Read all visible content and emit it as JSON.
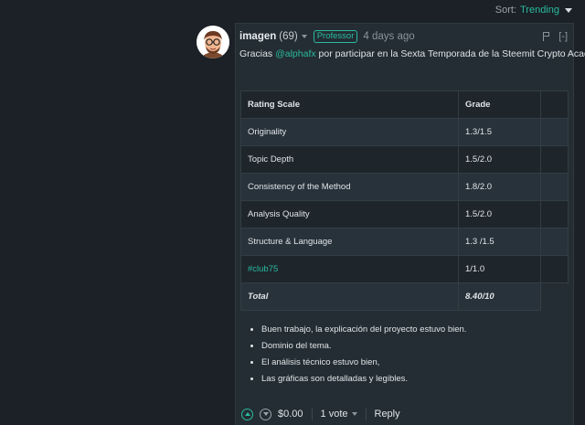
{
  "sort": {
    "label": "Sort:",
    "value": "Trending"
  },
  "comment": {
    "author": "imagen",
    "reputation": "(69)",
    "badge": "Professor",
    "time": "4 days ago",
    "collapse": "[-]",
    "intro_before": "Gracias ",
    "mention": "@alphafx",
    "intro_after": " por participar en la Sexta Temporada de la Steemit Crypto Academy."
  },
  "table": {
    "headers": [
      "Rating Scale",
      "Grade"
    ],
    "rows": [
      [
        "Originality",
        "1.3/1.5"
      ],
      [
        "Topic Depth",
        "1.5/2.0"
      ],
      [
        "Consistency of the Method",
        "1.8/2.0"
      ],
      [
        "Analysis Quality",
        "1.5/2.0"
      ],
      [
        "Structure & Language",
        "1.3 /1.5"
      ],
      [
        "#club75",
        "1/1.0"
      ],
      [
        "Total",
        "8.40/10"
      ]
    ]
  },
  "notes": [
    "Buen trabajo, la explicación del proyecto estuvo bien.",
    "Dominio del tema.",
    "El análisis técnico estuvo bien,",
    "Las gráficas son detalladas y legibles."
  ],
  "footer": {
    "payout": "$0.00",
    "votes": "1 vote",
    "reply": "Reply"
  },
  "colors": {
    "accent": "#2bb9a0",
    "background": "#1b2126",
    "panel": "#232d33"
  }
}
